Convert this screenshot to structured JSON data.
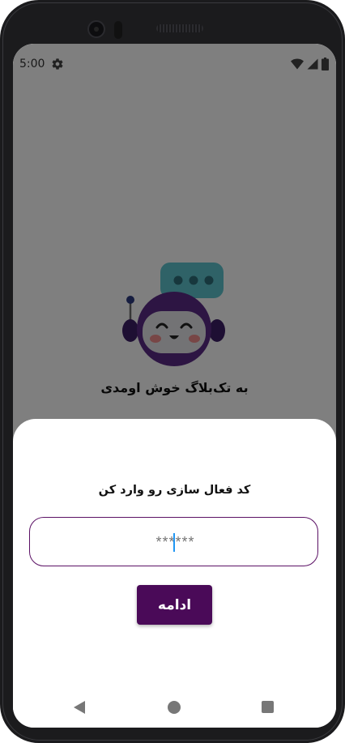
{
  "status_bar": {
    "time": "5:00",
    "icons": [
      "settings-gear-icon",
      "wifi-icon",
      "signal-icon",
      "battery-icon"
    ]
  },
  "app": {
    "welcome_text": "به تک‌بلاگ خوش اومدی",
    "mascot": "robot-mascot-with-chat-bubble"
  },
  "sheet": {
    "title": "کد فعال سازی رو وارد کن",
    "code_placeholder": "******",
    "continue_label": "ادامه"
  },
  "nav_bar": {
    "icons": [
      "back-icon",
      "home-icon",
      "recents-icon"
    ]
  },
  "colors": {
    "primary": "#4a0a58",
    "input_border": "#5b1165",
    "caret": "#2196f3",
    "scrim": "rgba(0,0,0,0.5)",
    "mascot_purple": "#5b2a86",
    "bubble_teal": "#5fc4cf"
  }
}
